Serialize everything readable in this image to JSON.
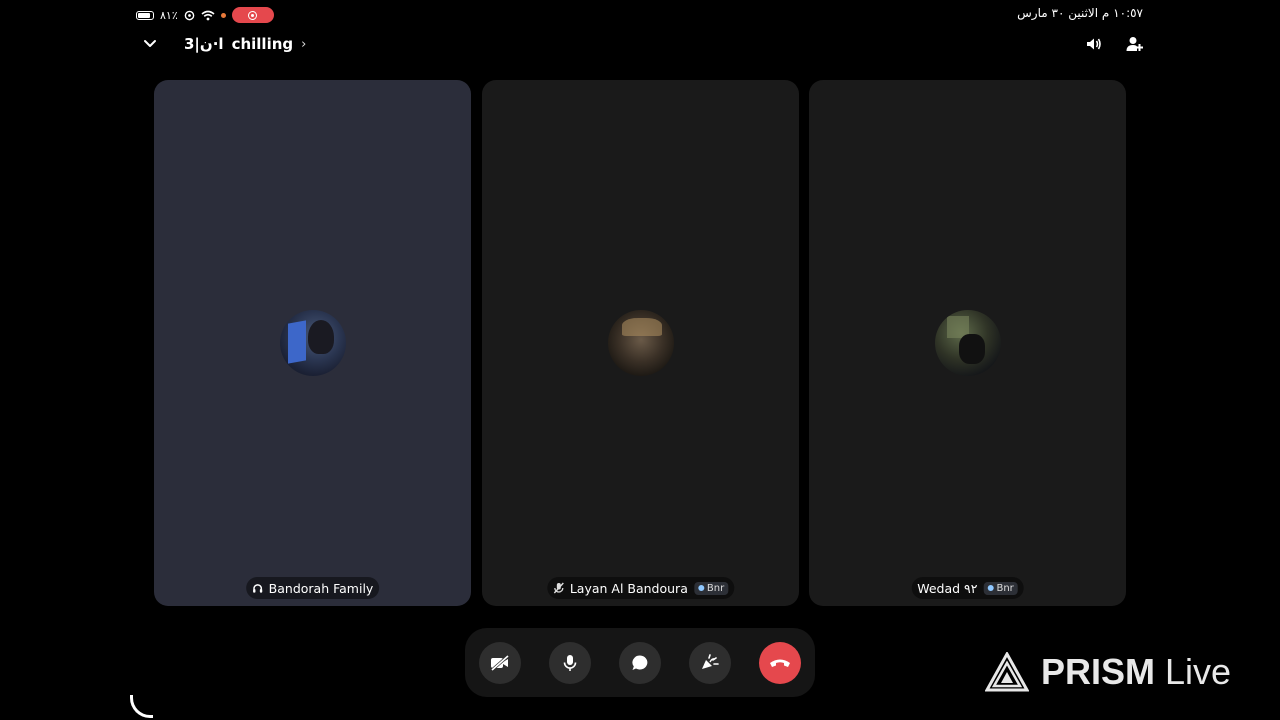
{
  "status_bar": {
    "battery_text": "٨١٪",
    "datetime": "١٠:٥٧ م  الاثنين ٣٠ مارس"
  },
  "header": {
    "channel_prefix": "3|ا·ن",
    "channel_name": "chilling"
  },
  "participants": [
    {
      "name": "Bandorah Family",
      "badge": ""
    },
    {
      "name": "Layan Al Bandoura",
      "badge": "Bnr"
    },
    {
      "name": "Wedad ٩٢",
      "badge": "Bnr"
    }
  ],
  "controls": {
    "buttons": [
      "camera-off",
      "microphone",
      "chat",
      "soundboard",
      "end-call"
    ]
  },
  "watermark": {
    "brand": "PRISM",
    "suffix": "Live"
  },
  "colors": {
    "background": "#000000",
    "tile_active": "#2b2d3a",
    "tile_idle": "#1a1a1a",
    "end_call": "#e5484d",
    "record_pill": "#e5484d"
  }
}
